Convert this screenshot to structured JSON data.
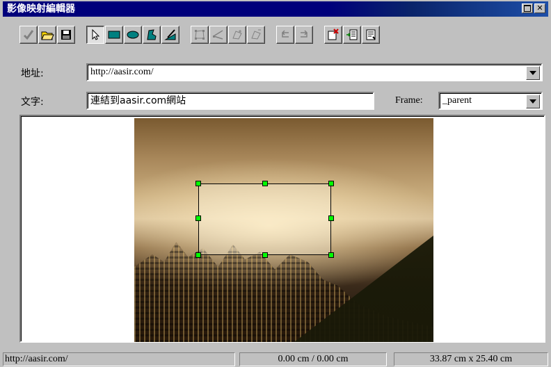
{
  "window": {
    "title": "影像映射編輯器"
  },
  "toolbar": {
    "buttons": [
      {
        "icon": "checkmark-icon",
        "state": "disabled"
      },
      {
        "icon": "open-folder-icon"
      },
      {
        "icon": "save-disk-icon"
      },
      {
        "icon": "pointer-arrow-icon",
        "state": "pressed"
      },
      {
        "icon": "rectangle-tool-icon"
      },
      {
        "icon": "ellipse-tool-icon"
      },
      {
        "icon": "polygon-tool-icon"
      },
      {
        "icon": "draw-tool-icon"
      },
      {
        "icon": "select-points-icon",
        "state": "disabled"
      },
      {
        "icon": "add-point-icon",
        "state": "disabled"
      },
      {
        "icon": "move-point-icon",
        "state": "disabled"
      },
      {
        "icon": "delete-point-icon",
        "state": "disabled"
      },
      {
        "icon": "undo-icon",
        "state": "disabled"
      },
      {
        "icon": "redo-icon",
        "state": "disabled"
      },
      {
        "icon": "delete-area-icon"
      },
      {
        "icon": "properties-icon"
      },
      {
        "icon": "settings-icon"
      }
    ]
  },
  "form": {
    "address_label": "地址:",
    "address_value": "http://aasir.com/",
    "text_label": "文字:",
    "text_value": "連結到aasir.com網站",
    "frame_label": "Frame:",
    "frame_value": "_parent"
  },
  "status": {
    "url": "http://aasir.com/",
    "position": "0.00 cm / 0.00 cm",
    "size": "33.87 cm x 25.40 cm"
  }
}
